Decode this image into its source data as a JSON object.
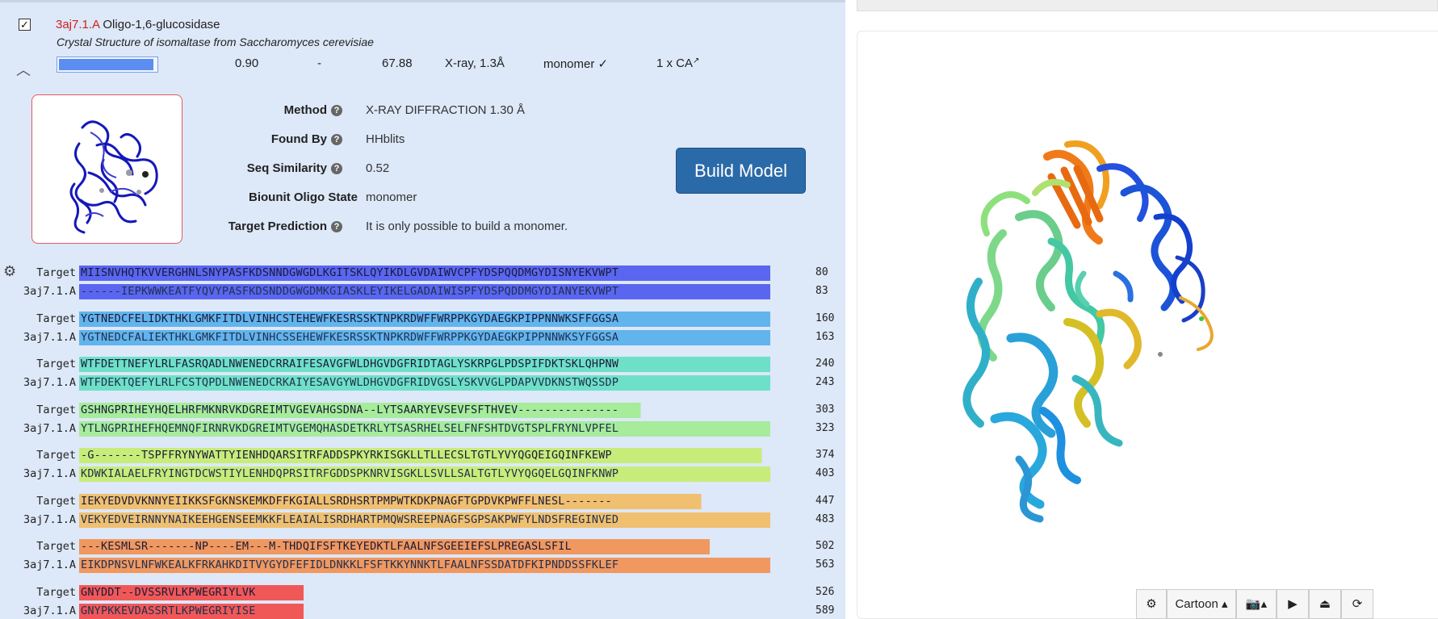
{
  "template": {
    "pdb_id": "3aj7.1.A",
    "name": "Oligo-1,6-glucosidase",
    "description": "Crystal Structure of isomaltase from Saccharomyces cerevisiae",
    "checked": true,
    "coverage_fraction": 0.96
  },
  "stats": {
    "gmqe": "0.90",
    "qmean": "-",
    "identity": "67.88",
    "method": "X-ray, 1.3Å",
    "oligo": "monomer ✓",
    "ligands": "1 x CA"
  },
  "details": {
    "method_label": "Method",
    "method_value": "X-RAY DIFFRACTION 1.30 Å",
    "found_by_label": "Found By",
    "found_by_value": "HHblits",
    "seq_sim_label": "Seq Similarity",
    "seq_sim_value": "0.52",
    "biounit_label": "Biounit Oligo State",
    "biounit_value": "monomer",
    "target_pred_label": "Target Prediction",
    "target_pred_value": "It is only possible to build a monomer."
  },
  "build_model_label": "Build Model",
  "alignment": {
    "colors": [
      "#5a66f0",
      "#62b4ec",
      "#6ee0c8",
      "#a6ec9a",
      "#c8ec7a",
      "#f0c070",
      "#f09860",
      "#f05858"
    ],
    "blocks": [
      {
        "target_label": "Target",
        "target_seq": "MIISNVHQTKVVERGHNLSNYPASFKDSNNDGWGDLKGITSKLQYIKDLGVDAIWVCPFYDSPQQDMGYDISNYEKVWPT",
        "target_num": "80",
        "tmpl_label": "3aj7.1.A",
        "tmpl_seq": "------IEPKWWKEATFYQVYPASFKDSNDDGWGDMKGIASKLEYIKELGADAIWISPFYDSPQDDMGYDIANYEKVWPT",
        "tmpl_num": "83"
      },
      {
        "target_label": "Target",
        "target_seq": "YGTNEDCFELIDKTHKLGMKFITDLVINHCSTEHEWFKESRSSKTNPKRDWFFWRPPKGYDAEGKPIPPNNWKSFFGGSA",
        "target_num": "160",
        "tmpl_label": "3aj7.1.A",
        "tmpl_seq": "YGTNEDCFALIEKTHKLGMKFITDLVINHCSSEHEWFKESRSSKTNPKRDWFFWRPPKGYDAEGKPIPPNNWKSYFGGSA",
        "tmpl_num": "163"
      },
      {
        "target_label": "Target",
        "target_seq": "WTFDETTNEFYLRLFASRQADLNWENEDCRRAIFESAVGFWLDHGVDGFRIDTAGLYSKRPGLPDSPIFDKTSKLQHPNW",
        "target_num": "240",
        "tmpl_label": "3aj7.1.A",
        "tmpl_seq": "WTFDEKTQEFYLRLFCSTQPDLNWENEDCRKAIYESAVGYWLDHGVDGFRIDVGSLYSKVVGLPDAPVVDKNSTWQSSDP",
        "tmpl_num": "243"
      },
      {
        "target_label": "Target",
        "target_seq": "GSHNGPRIHEYHQELHRFMKNRVKDGREIMTVGEVAHGSDNA--LYTSAARYEVSEVFSFTHVEV---------------",
        "target_num": "303",
        "tmpl_label": "3aj7.1.A",
        "tmpl_seq": "YTLNGPRIHEFHQEMNQFIRNRVKDGREIMTVGEMQHASDETKRLYTSASRHELSELFNFSHTDVGTSPLFRYNLVPFEL",
        "tmpl_num": "323"
      },
      {
        "target_label": "Target",
        "target_seq": "-G-------TSPFFRYNYWATTYIENHDQARSITRFADDSPKYRKISGKLLTLLECSLTGTLYVYQGQEIGQINFKEWP",
        "target_num": "374",
        "tmpl_label": "3aj7.1.A",
        "tmpl_seq": "KDWKIALAELFRYINGTDCWSTIYLENHDQPRSITRFGDDSPKNRVISGKLLSVLLSALTGTLYVYQGQELGQINFKNWP",
        "tmpl_num": "403"
      },
      {
        "target_label": "Target",
        "target_seq": "IEKYEDVDVKNNYEIIKKSFGKNSKEMKDFFKGIALLSRDHSRTPMPWTKDKPNAGFTGPDVKPWFFLNESL-------",
        "target_num": "447",
        "tmpl_label": "3aj7.1.A",
        "tmpl_seq": "VEKYEDVEIRNNYNAIKEEHGENSEEMKKFLEAIALISRDHARTPMQWSREEPNAGFSGPSAKPWFYLNDSFREGINVED",
        "tmpl_num": "483"
      },
      {
        "target_label": "Target",
        "target_seq": "---KESMLSR-------NP----EM---M-THDQIFSFTKEYEDKTLFAALNFSGEEIEFSLPREGASLSFIL",
        "target_num": "502",
        "tmpl_label": "3aj7.1.A",
        "tmpl_seq": "EIKDPNSVLNFWKEALKFRKAHKDITVYGYDFEFIDLDNKKLFSFTKKYNNKTLFAALNFSSDATDFKIPNDDSSFKLEF",
        "tmpl_num": "563"
      },
      {
        "target_label": "Target",
        "target_seq": "GNYDDT--DVSSRVLKPWEGRIYLVK",
        "target_num": "526",
        "tmpl_label": "3aj7.1.A",
        "tmpl_seq": "GNYPKKEVDASSRTLKPWEGRIYISE",
        "tmpl_num": "589"
      }
    ]
  },
  "viewer": {
    "style_label": "Cartoon",
    "tools": [
      "gear-icon",
      "style-dropdown",
      "camera-icon",
      "play-icon",
      "eject-icon",
      "refresh-icon"
    ]
  }
}
